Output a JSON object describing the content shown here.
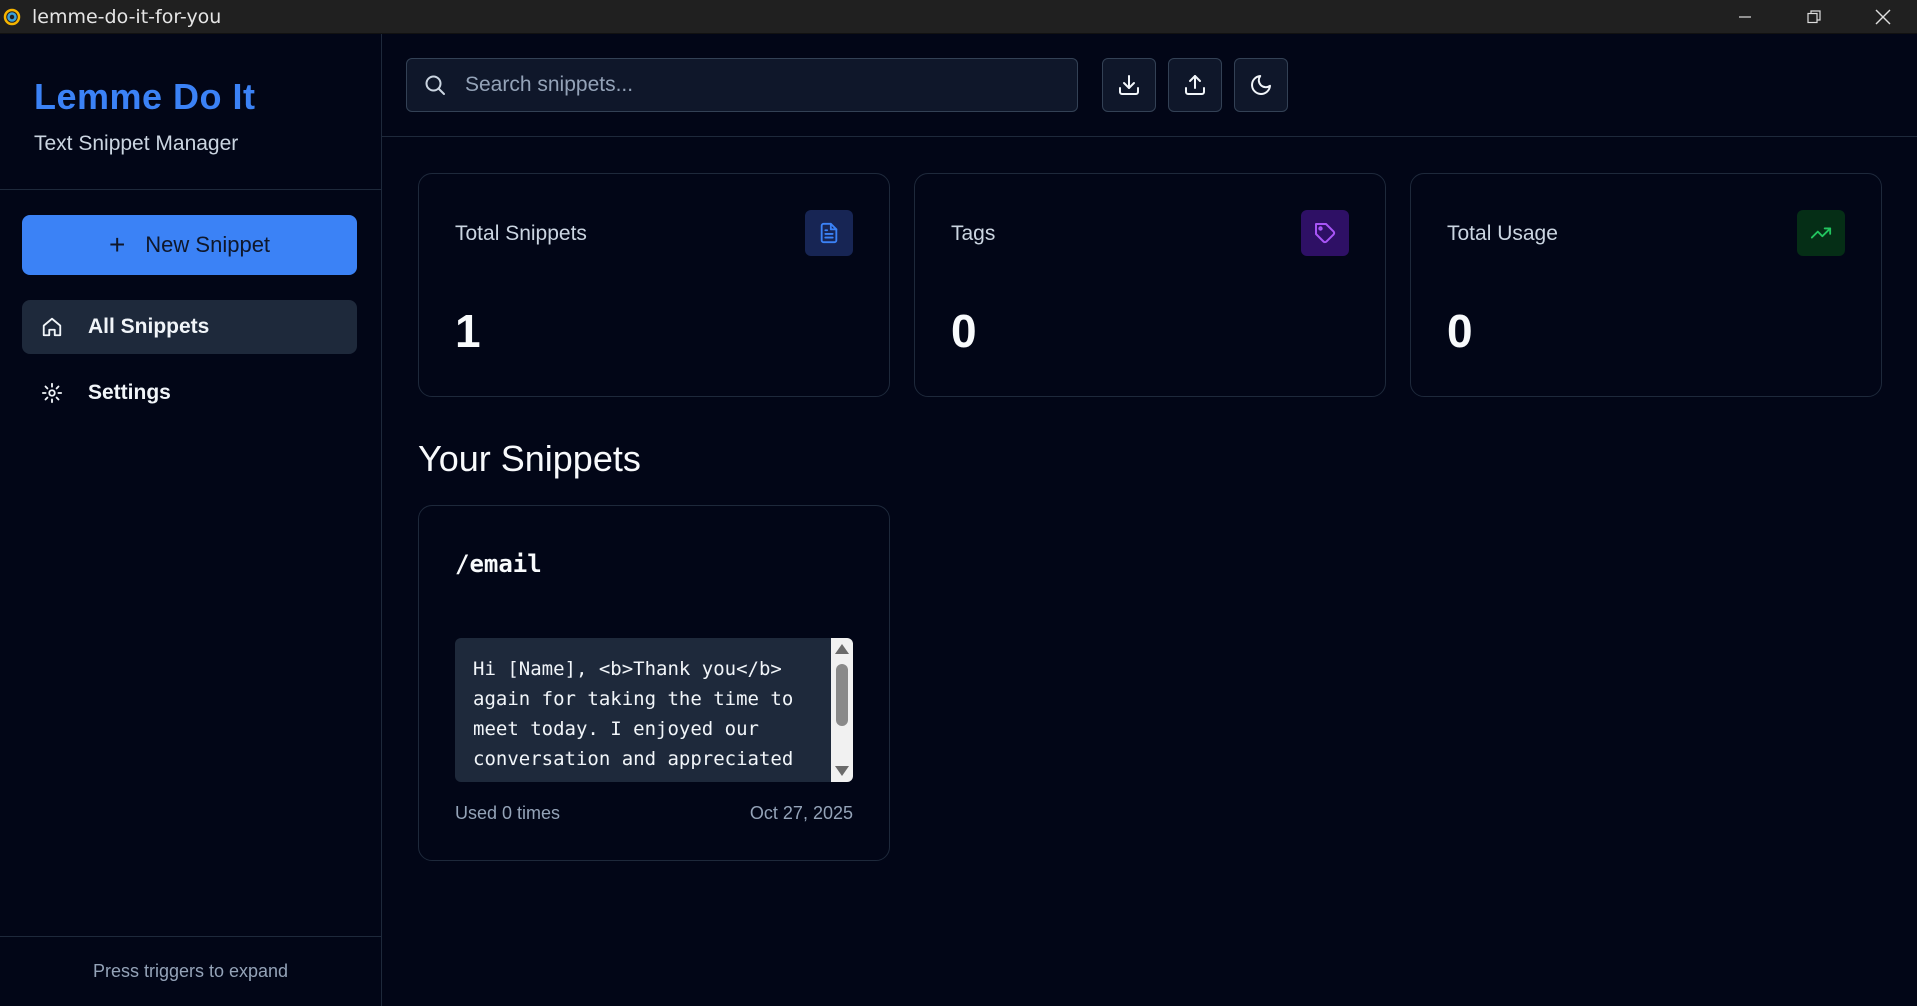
{
  "window": {
    "title": "lemme-do-it-for-you",
    "app_icon": "app-logo-icon",
    "controls": [
      "minimize-icon",
      "restore-icon",
      "close-icon"
    ]
  },
  "sidebar": {
    "brand_title": "Lemme Do It",
    "brand_subtitle": "Text Snippet Manager",
    "new_button_label": "New Snippet",
    "items": [
      {
        "label": "All Snippets",
        "icon": "home-icon",
        "active": true
      },
      {
        "label": "Settings",
        "icon": "gear-icon",
        "active": false
      }
    ],
    "footer": "Press triggers to expand"
  },
  "topbar": {
    "search_placeholder": "Search snippets...",
    "search_value": "",
    "tools": [
      "download-icon",
      "upload-icon",
      "moon-icon"
    ]
  },
  "stats": [
    {
      "label": "Total Snippets",
      "value": "1",
      "icon": "document-icon",
      "color": "#3b82f6"
    },
    {
      "label": "Tags",
      "value": "0",
      "icon": "tag-icon",
      "color": "#a855f7"
    },
    {
      "label": "Total Usage",
      "value": "0",
      "icon": "trending-up-icon",
      "color": "#22c55e"
    }
  ],
  "section_title": "Your Snippets",
  "snippets": [
    {
      "trigger": "/email",
      "content": "Hi [Name], <b>Thank you</b>\nagain for taking the time to\nmeet today. I enjoyed our\nconversation and appreciated",
      "usage": "Used 0 times",
      "date": "Oct 27, 2025"
    }
  ],
  "colors": {
    "background": "#020617",
    "accent": "#3b82f6",
    "surface": "#1e293b"
  }
}
